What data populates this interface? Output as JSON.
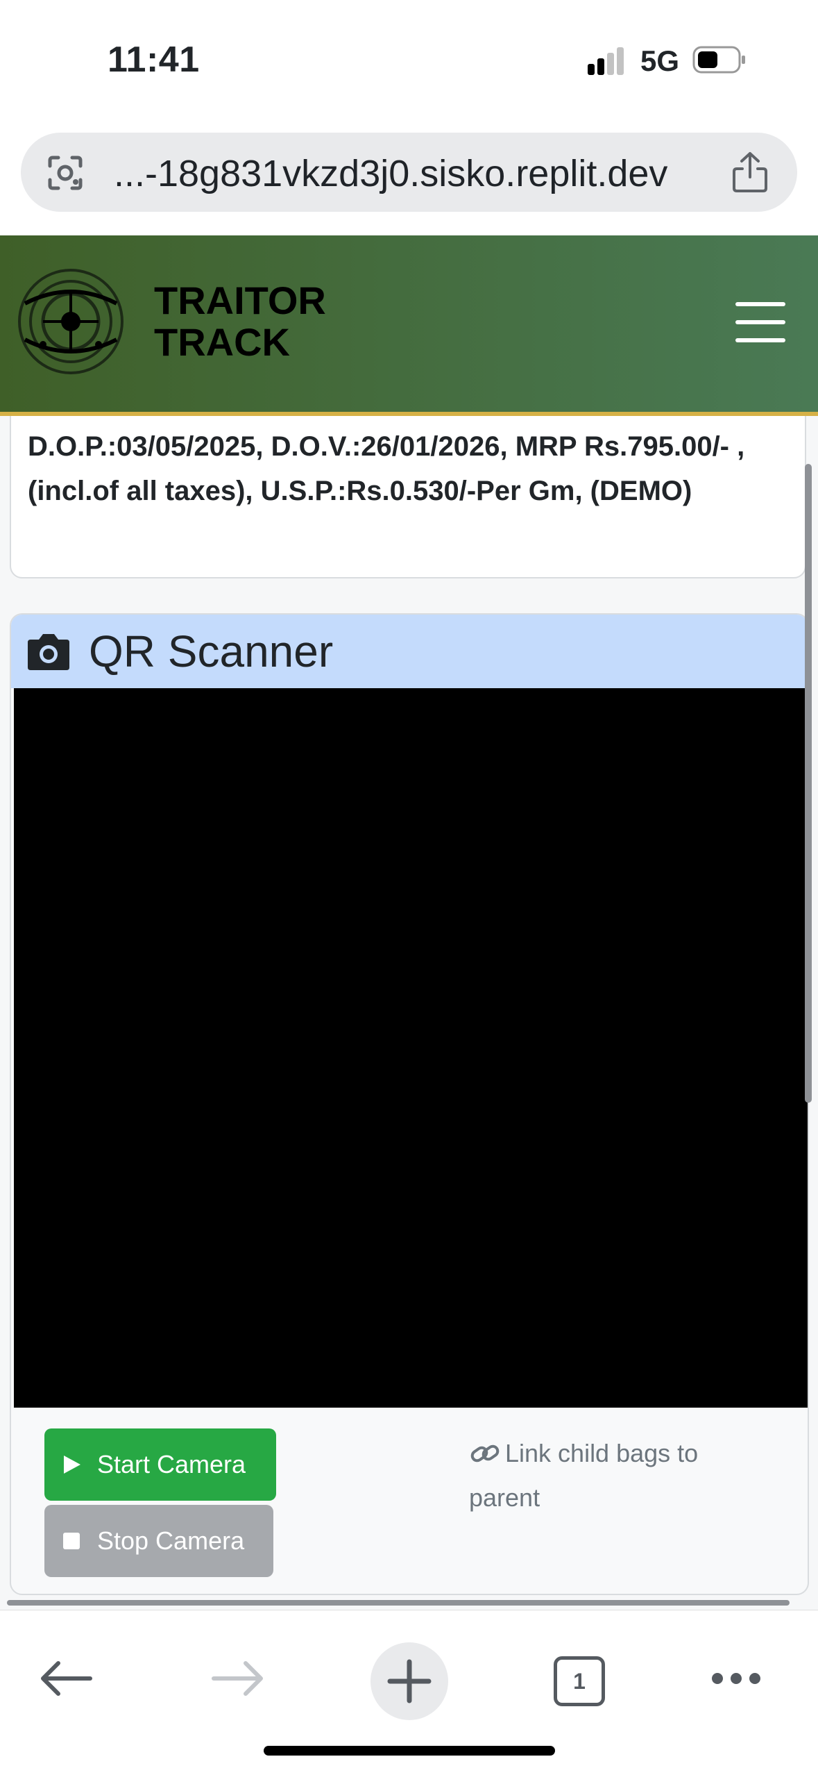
{
  "status_bar": {
    "time": "11:41",
    "network": "5G"
  },
  "browser": {
    "url": "...-18g831vkzd3j0.sisko.replit.dev",
    "tab_count": "1"
  },
  "navbar": {
    "brand_line1": "TRAITOR",
    "brand_line2": "TRACK"
  },
  "info_card": {
    "text": "D.O.P.:03/05/2025, D.O.V.:26/01/2026, MRP Rs.795.00/- , (incl.of all taxes), U.S.P.:Rs.0.530/-Per Gm, (DEMO)"
  },
  "scanner": {
    "title": "QR Scanner",
    "start_label": "Start Camera",
    "stop_label": "Stop Camera",
    "link_label": "Link child bags to parent"
  },
  "colors": {
    "navbar_start": "#3f5f28",
    "navbar_end": "#4a7a55",
    "navbar_border": "#d6b146",
    "scanner_header": "#c4dbfc",
    "start_button": "#27a844",
    "stop_button": "#a6a9ad"
  },
  "icons": [
    "lens-icon",
    "share-icon",
    "logo-icon",
    "menu-icon",
    "camera-icon",
    "play-icon",
    "stop-icon",
    "link-icon",
    "back-icon",
    "forward-icon",
    "plus-icon",
    "tabs-icon",
    "more-icon"
  ]
}
